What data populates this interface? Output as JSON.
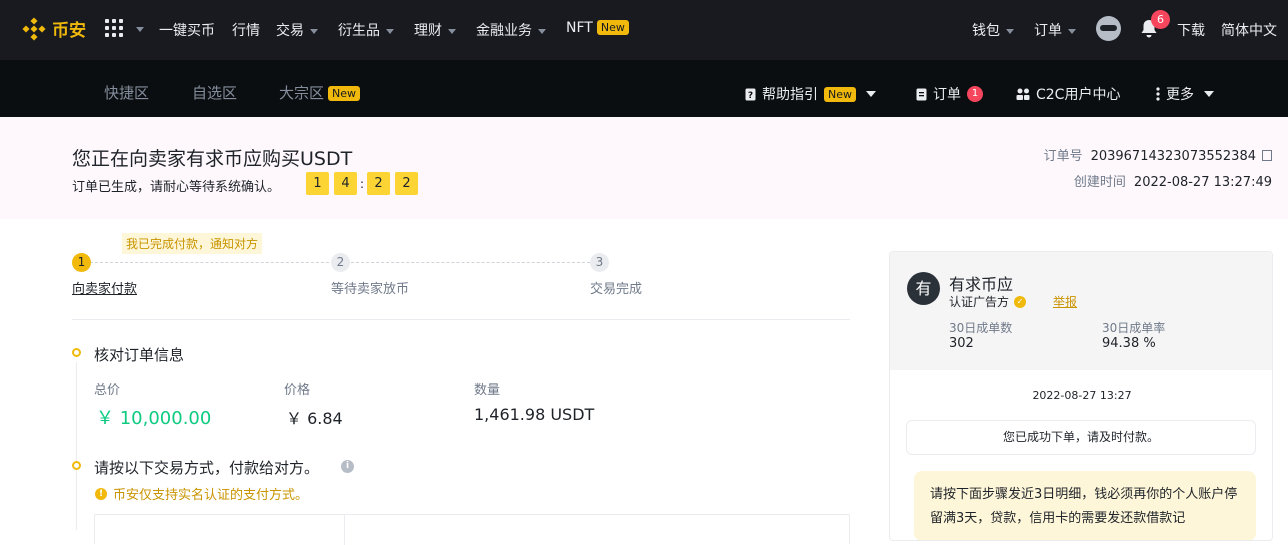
{
  "topnav": {
    "brand": "币安",
    "items": [
      "一键买币",
      "行情",
      "交易",
      "衍生品",
      "理财",
      "金融业务",
      "NFT"
    ],
    "nft_badge": "New",
    "right": {
      "wallet": "钱包",
      "orders": "订单",
      "notifications": "6",
      "download": "下载",
      "language": "简体中文"
    }
  },
  "subnav": {
    "tabs": [
      "快捷区",
      "自选区",
      "大宗区"
    ],
    "bulk_badge": "New",
    "help": "帮助指引",
    "help_badge": "New",
    "orders": "订单",
    "orders_count": "1",
    "c2c_center": "C2C用户中心",
    "more": "更多"
  },
  "order": {
    "title": "您正在向卖家有求币应购买USDT",
    "subtitle": "订单已生成，请耐心等待系统确认。",
    "timer": [
      "1",
      "4",
      "2",
      "2"
    ],
    "timer_sep": ":",
    "order_no_label": "订单号",
    "order_no": "20396714323073552384",
    "created_label": "创建时间",
    "created": "2022-08-27 13:27:49"
  },
  "steps": {
    "hint": "我已完成付款，通知对方",
    "items": [
      {
        "num": "1",
        "label": "向卖家付款"
      },
      {
        "num": "2",
        "label": "等待卖家放币"
      },
      {
        "num": "3",
        "label": "交易完成"
      }
    ]
  },
  "verify": {
    "title": "核对订单信息",
    "total_label": "总价",
    "total": "￥ 10,000.00",
    "price_label": "价格",
    "price": "￥ 6.84",
    "qty_label": "数量",
    "qty": "1,461.98 USDT"
  },
  "payment": {
    "title": "请按以下交易方式，付款给对方。",
    "warning": "币安仅支持实名认证的支付方式。"
  },
  "seller": {
    "avatar_char": "有",
    "name": "有求币应",
    "cert": "认证广告方",
    "report": "举报",
    "orders_30d_label": "30日成单数",
    "orders_30d": "302",
    "rate_30d_label": "30日成单率",
    "rate_30d": "94.38 %",
    "chat_time": "2022-08-27 13:27",
    "chat_msg": "您已成功下单，请及时付款。",
    "chat_note": "请按下面步骤发近3日明细，钱必须再你的个人账户停留满3天，贷款，信用卡的需要发还款借款记"
  },
  "colors": {
    "brand": "#f0b90b",
    "green": "#0ecb81",
    "red": "#f6465d"
  }
}
